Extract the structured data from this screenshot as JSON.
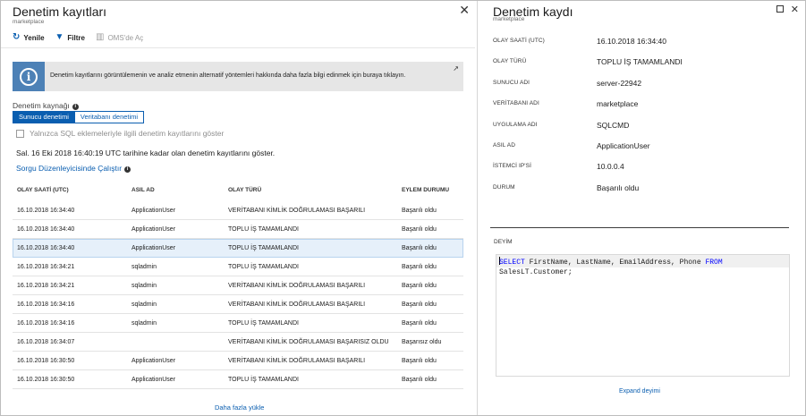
{
  "left": {
    "title": "Denetim kayıtları",
    "subtitle": "marketplace",
    "toolbar": {
      "refresh": "Yenile",
      "filter": "Filtre",
      "oms": "OMS'de Aç"
    },
    "info_banner": "Denetim kayıtlarını görüntülemenin ve analiz etmenin alternatif yöntemleri hakkında daha fazla bilgi edinmek için buraya tıklayın.",
    "source_label": "Denetim kaynağı",
    "source_options": [
      "Sunucu denetimi",
      "Veritabanı denetimi"
    ],
    "checkbox_label": "Yalnızca SQL eklemeleriyle ilgili denetim kayıtlarını göster",
    "range_note": "Sal. 16 Eki 2018 16:40:19 UTC tarihine kadar olan denetim kayıtlarını göster.",
    "query_link": "Sorgu Düzenleyicisinde Çalıştır",
    "columns": [
      "OLAY SAATİ (UTC)",
      "ASIL AD",
      "OLAY TÜRÜ",
      "EYLEM DURUMU"
    ],
    "rows": [
      [
        "16.10.2018 16:34:40",
        "ApplicationUser",
        "VERİTABANI KİMLİK DOĞRULAMASI BAŞARILI",
        "Başarılı oldu"
      ],
      [
        "16.10.2018 16:34:40",
        "ApplicationUser",
        "TOPLU İŞ TAMAMLANDI",
        "Başarılı oldu"
      ],
      [
        "16.10.2018 16:34:40",
        "ApplicationUser",
        "TOPLU İŞ TAMAMLANDI",
        "Başarılı oldu"
      ],
      [
        "16.10.2018 16:34:21",
        "sqladmin",
        "TOPLU İŞ TAMAMLANDI",
        "Başarılı oldu"
      ],
      [
        "16.10.2018 16:34:21",
        "sqladmin",
        "VERİTABANI KİMLİK DOĞRULAMASI BAŞARILI",
        "Başarılı oldu"
      ],
      [
        "16.10.2018 16:34:16",
        "sqladmin",
        "VERİTABANI KİMLİK DOĞRULAMASI BAŞARILI",
        "Başarılı oldu"
      ],
      [
        "16.10.2018 16:34:16",
        "sqladmin",
        "TOPLU İŞ TAMAMLANDI",
        "Başarılı oldu"
      ],
      [
        "16.10.2018 16:34:07",
        "",
        "VERİTABANI KİMLİK DOĞRULAMASI BAŞARISIZ OLDU",
        "Başarısız oldu"
      ],
      [
        "16.10.2018 16:30:50",
        "ApplicationUser",
        "VERİTABANI KİMLİK DOĞRULAMASI BAŞARILI",
        "Başarılı oldu"
      ],
      [
        "16.10.2018 16:30:50",
        "ApplicationUser",
        "TOPLU İŞ TAMAMLANDI",
        "Başarılı oldu"
      ]
    ],
    "load_more": "Daha fazla yükle"
  },
  "right": {
    "title": "Denetim kaydı",
    "subtitle": "marketplace",
    "props": [
      {
        "k": "OLAY SAATİ (UTC)",
        "v": "16.10.2018 16:34:40"
      },
      {
        "k": "OLAY TÜRÜ",
        "v": "TOPLU İŞ TAMAMLANDI"
      },
      {
        "k": "SUNUCU ADI",
        "v": "server-22942"
      },
      {
        "k": "VERİTABANI ADI",
        "v": "marketplace"
      },
      {
        "k": "UYGULAMA ADI",
        "v": "SQLCMD"
      },
      {
        "k": "ASIL AD",
        "v": "ApplicationUser"
      },
      {
        "k": "İSTEMCİ IP'Sİ",
        "v": "10.0.0.4"
      },
      {
        "k": "DURUM",
        "v": "Başarılı oldu"
      }
    ],
    "statement_label": "DEYİM",
    "code": {
      "kw1": "SELECT",
      "cols": " FirstName, LastName, EmailAddress, Phone ",
      "kw2": "FROM",
      "line2": "SalesLT.Customer;"
    },
    "expand_link": "Expand deyimi"
  }
}
